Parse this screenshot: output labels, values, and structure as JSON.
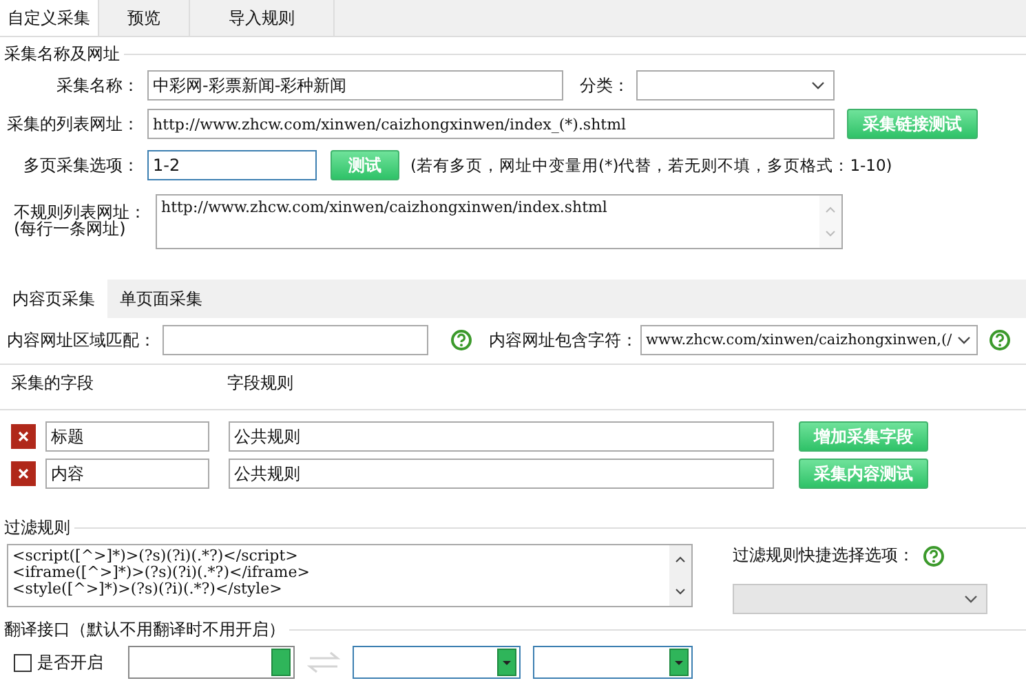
{
  "tabs": [
    {
      "label": "自定义采集",
      "selected": true
    },
    {
      "label": "预览",
      "selected": false
    },
    {
      "label": "导入规则",
      "selected": false
    }
  ],
  "basic": {
    "legend": "采集名称及网址",
    "name": {
      "label": "采集名称：",
      "value": "中彩网-彩票新闻-彩种新闻"
    },
    "category": {
      "label": "分类："
    },
    "list_url": {
      "label": "采集的列表网址：",
      "value": "http://www.zhcw.com/xinwen/caizhongxinwen/index_(*).shtml",
      "button": "采集链接测试"
    },
    "pages": {
      "label": "多页采集选项：",
      "value": "1-2",
      "button": "测试",
      "note": "(若有多页，网址中变量用(*)代替，若无则不填，多页格式：1-10)"
    },
    "irregular": {
      "label": "不规则列表网址：",
      "sublabel": "(每行一条网址)",
      "value": "http://www.zhcw.com/xinwen/caizhongxinwen/index.shtml"
    }
  },
  "sub_tabs": [
    {
      "label": "内容页采集",
      "selected": true
    },
    {
      "label": "单页面采集",
      "selected": false
    }
  ],
  "content": {
    "region": {
      "label": "内容网址区域匹配："
    },
    "contains": {
      "label": "内容网址包含字符：",
      "value": "www.zhcw.com/xinwen/caizhongxinwen,(/"
    }
  },
  "fields": {
    "header_name": "采集的字段",
    "header_rule": "字段规则",
    "rows": [
      {
        "name": "标题",
        "rule": "公共规则",
        "button": "增加采集字段"
      },
      {
        "name": "内容",
        "rule": "公共规则",
        "button": "采集内容测试"
      }
    ]
  },
  "filter": {
    "legend": "过滤规则",
    "lines": [
      "<script([^>]*)>(?s)(?i)(.*?)</script>",
      "<iframe([^>]*)>(?s)(?i)(.*?)</iframe>",
      "<style([^>]*)>(?s)(?i)(.*?)</style>"
    ],
    "quick_label": "过滤规则快捷选择选项：",
    "quick_disabled": true
  },
  "translate": {
    "legend": "翻译接口（默认不用翻译时不用开启）",
    "enable": {
      "label": "是否开启",
      "checked": false
    }
  }
}
